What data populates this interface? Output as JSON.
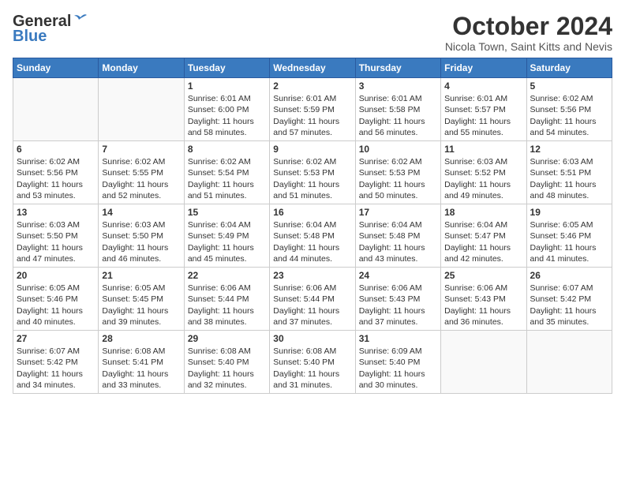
{
  "logo": {
    "line1": "General",
    "line2": "Blue"
  },
  "title": "October 2024",
  "location": "Nicola Town, Saint Kitts and Nevis",
  "weekdays": [
    "Sunday",
    "Monday",
    "Tuesday",
    "Wednesday",
    "Thursday",
    "Friday",
    "Saturday"
  ],
  "weeks": [
    [
      {
        "day": "",
        "info": ""
      },
      {
        "day": "",
        "info": ""
      },
      {
        "day": "1",
        "info": "Sunrise: 6:01 AM\nSunset: 6:00 PM\nDaylight: 11 hours and 58 minutes."
      },
      {
        "day": "2",
        "info": "Sunrise: 6:01 AM\nSunset: 5:59 PM\nDaylight: 11 hours and 57 minutes."
      },
      {
        "day": "3",
        "info": "Sunrise: 6:01 AM\nSunset: 5:58 PM\nDaylight: 11 hours and 56 minutes."
      },
      {
        "day": "4",
        "info": "Sunrise: 6:01 AM\nSunset: 5:57 PM\nDaylight: 11 hours and 55 minutes."
      },
      {
        "day": "5",
        "info": "Sunrise: 6:02 AM\nSunset: 5:56 PM\nDaylight: 11 hours and 54 minutes."
      }
    ],
    [
      {
        "day": "6",
        "info": "Sunrise: 6:02 AM\nSunset: 5:56 PM\nDaylight: 11 hours and 53 minutes."
      },
      {
        "day": "7",
        "info": "Sunrise: 6:02 AM\nSunset: 5:55 PM\nDaylight: 11 hours and 52 minutes."
      },
      {
        "day": "8",
        "info": "Sunrise: 6:02 AM\nSunset: 5:54 PM\nDaylight: 11 hours and 51 minutes."
      },
      {
        "day": "9",
        "info": "Sunrise: 6:02 AM\nSunset: 5:53 PM\nDaylight: 11 hours and 51 minutes."
      },
      {
        "day": "10",
        "info": "Sunrise: 6:02 AM\nSunset: 5:53 PM\nDaylight: 11 hours and 50 minutes."
      },
      {
        "day": "11",
        "info": "Sunrise: 6:03 AM\nSunset: 5:52 PM\nDaylight: 11 hours and 49 minutes."
      },
      {
        "day": "12",
        "info": "Sunrise: 6:03 AM\nSunset: 5:51 PM\nDaylight: 11 hours and 48 minutes."
      }
    ],
    [
      {
        "day": "13",
        "info": "Sunrise: 6:03 AM\nSunset: 5:50 PM\nDaylight: 11 hours and 47 minutes."
      },
      {
        "day": "14",
        "info": "Sunrise: 6:03 AM\nSunset: 5:50 PM\nDaylight: 11 hours and 46 minutes."
      },
      {
        "day": "15",
        "info": "Sunrise: 6:04 AM\nSunset: 5:49 PM\nDaylight: 11 hours and 45 minutes."
      },
      {
        "day": "16",
        "info": "Sunrise: 6:04 AM\nSunset: 5:48 PM\nDaylight: 11 hours and 44 minutes."
      },
      {
        "day": "17",
        "info": "Sunrise: 6:04 AM\nSunset: 5:48 PM\nDaylight: 11 hours and 43 minutes."
      },
      {
        "day": "18",
        "info": "Sunrise: 6:04 AM\nSunset: 5:47 PM\nDaylight: 11 hours and 42 minutes."
      },
      {
        "day": "19",
        "info": "Sunrise: 6:05 AM\nSunset: 5:46 PM\nDaylight: 11 hours and 41 minutes."
      }
    ],
    [
      {
        "day": "20",
        "info": "Sunrise: 6:05 AM\nSunset: 5:46 PM\nDaylight: 11 hours and 40 minutes."
      },
      {
        "day": "21",
        "info": "Sunrise: 6:05 AM\nSunset: 5:45 PM\nDaylight: 11 hours and 39 minutes."
      },
      {
        "day": "22",
        "info": "Sunrise: 6:06 AM\nSunset: 5:44 PM\nDaylight: 11 hours and 38 minutes."
      },
      {
        "day": "23",
        "info": "Sunrise: 6:06 AM\nSunset: 5:44 PM\nDaylight: 11 hours and 37 minutes."
      },
      {
        "day": "24",
        "info": "Sunrise: 6:06 AM\nSunset: 5:43 PM\nDaylight: 11 hours and 37 minutes."
      },
      {
        "day": "25",
        "info": "Sunrise: 6:06 AM\nSunset: 5:43 PM\nDaylight: 11 hours and 36 minutes."
      },
      {
        "day": "26",
        "info": "Sunrise: 6:07 AM\nSunset: 5:42 PM\nDaylight: 11 hours and 35 minutes."
      }
    ],
    [
      {
        "day": "27",
        "info": "Sunrise: 6:07 AM\nSunset: 5:42 PM\nDaylight: 11 hours and 34 minutes."
      },
      {
        "day": "28",
        "info": "Sunrise: 6:08 AM\nSunset: 5:41 PM\nDaylight: 11 hours and 33 minutes."
      },
      {
        "day": "29",
        "info": "Sunrise: 6:08 AM\nSunset: 5:40 PM\nDaylight: 11 hours and 32 minutes."
      },
      {
        "day": "30",
        "info": "Sunrise: 6:08 AM\nSunset: 5:40 PM\nDaylight: 11 hours and 31 minutes."
      },
      {
        "day": "31",
        "info": "Sunrise: 6:09 AM\nSunset: 5:40 PM\nDaylight: 11 hours and 30 minutes."
      },
      {
        "day": "",
        "info": ""
      },
      {
        "day": "",
        "info": ""
      }
    ]
  ]
}
